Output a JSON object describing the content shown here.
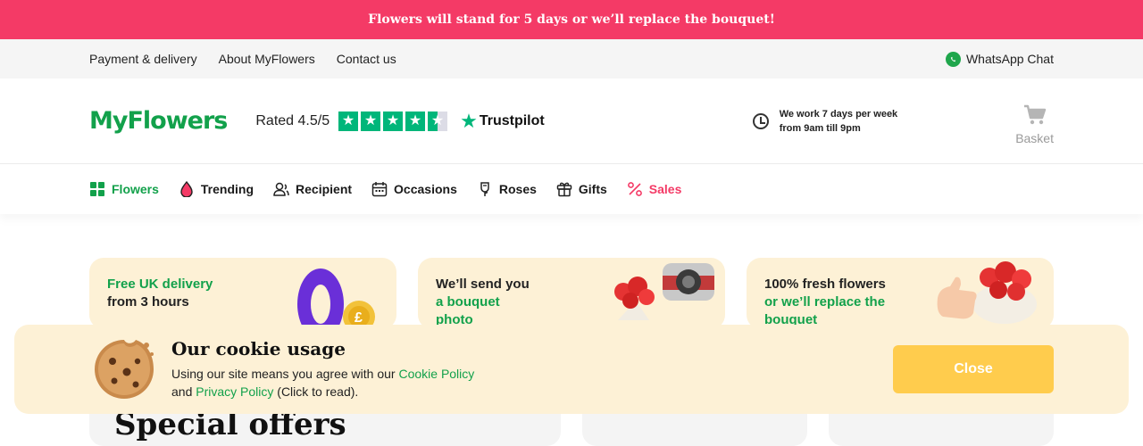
{
  "promo": {
    "text": "Flowers will stand for 5 days or we’ll replace the bouquet!"
  },
  "topnav": {
    "links": [
      "Payment & delivery",
      "About MyFlowers",
      "Contact us"
    ],
    "whatsapp_label": "WhatsApp Chat"
  },
  "header": {
    "logo": "MyFlowers",
    "rating_label": "Rated 4.5/5",
    "rating_value": 4.5,
    "trustpilot_label": "Trustpilot",
    "hours_line1": "We work 7 days per week",
    "hours_line2": "from 9am till 9pm",
    "basket_label": "Basket"
  },
  "categories": [
    {
      "label": "Flowers",
      "icon": "grid-icon"
    },
    {
      "label": "Trending",
      "icon": "drop-icon"
    },
    {
      "label": "Recipient",
      "icon": "person-icon"
    },
    {
      "label": "Occasions",
      "icon": "calendar-icon"
    },
    {
      "label": "Roses",
      "icon": "rose-icon"
    },
    {
      "label": "Gifts",
      "icon": "gift-icon"
    },
    {
      "label": "Sales",
      "icon": "percent-icon"
    }
  ],
  "features": [
    {
      "line1": "Free UK delivery",
      "line2": "from 3 hours"
    },
    {
      "line1": "We’ll send you",
      "line2": "a bouquet",
      "line3": "photo"
    },
    {
      "line1": "100% fresh flowers",
      "line2": "or we’ll replace the",
      "line3": "bouquet"
    }
  ],
  "offers": {
    "title": "Special offers"
  },
  "cookie": {
    "title": "Our cookie usage",
    "text1": "Using our site means you agree with our ",
    "cookie_policy": "Cookie Policy",
    "text2": "and ",
    "privacy_policy": "Privacy Policy",
    "text3": " (Click to read).",
    "close_label": "Close"
  },
  "colors": {
    "brand_green": "#12a14b",
    "accent_pink": "#f43a66",
    "cream": "#fdf1d6",
    "button_yellow": "#ffcc4d"
  }
}
